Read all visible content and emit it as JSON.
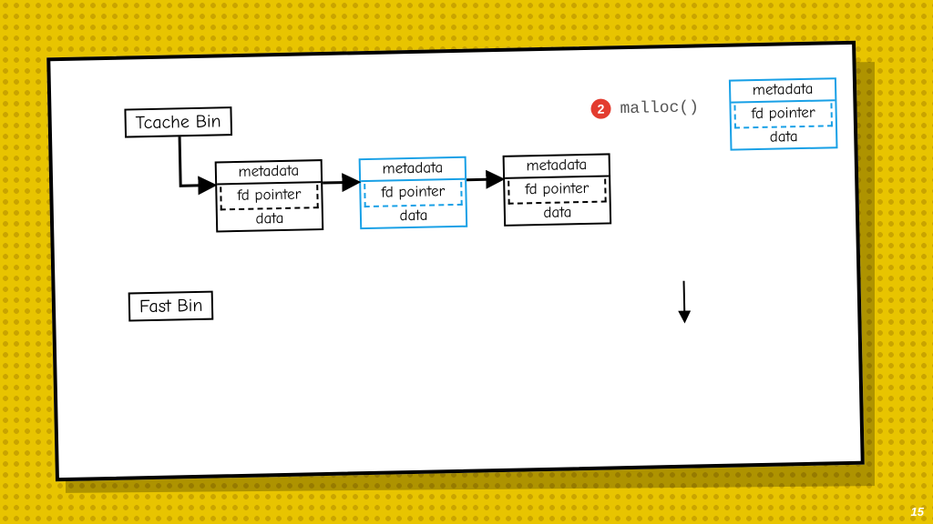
{
  "labels": {
    "tcache": "Tcache Bin",
    "fast": "Fast Bin"
  },
  "chunk": {
    "meta": "metadata",
    "fd": "fd pointer",
    "data": "data"
  },
  "step": {
    "num": "2",
    "call": "malloc()"
  },
  "page": "15"
}
